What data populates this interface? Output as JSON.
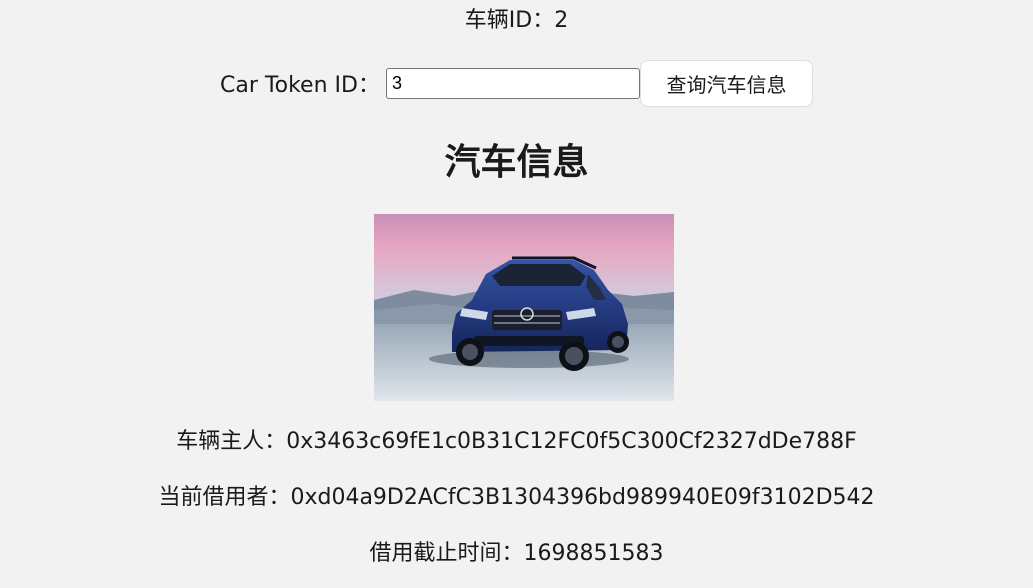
{
  "vehicle": {
    "id_label": "车辆ID：",
    "id_value": "2"
  },
  "query": {
    "label": "Car Token ID：",
    "input_value": "3",
    "button_label": "查询汽车信息"
  },
  "car_info": {
    "title": "汽车信息",
    "owner_label": "车辆主人：",
    "owner_value": "0x3463c69fE1c0B31C12FC0f5C300Cf2327dDe788F",
    "borrower_label": "当前借用者：",
    "borrower_value": "0xd04a9D2ACfC3B1304396bd989940E09f3102D542",
    "deadline_label": "借用截止时间：",
    "deadline_value": "1698851583"
  }
}
